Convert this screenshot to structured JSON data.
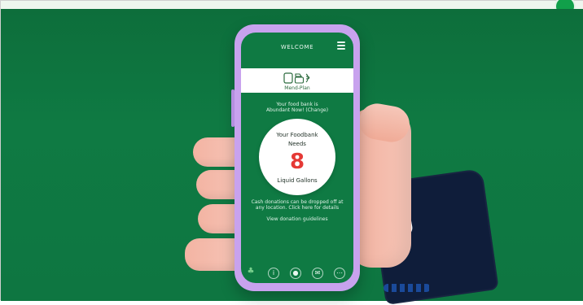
{
  "app": {
    "header_title": "WELCOME",
    "logo_text": "Mend-Plan",
    "subtext": "Your food bank is\nAbundant Now! (Change)",
    "needs": {
      "line1": "Your Foodbank",
      "line2": "Needs",
      "number": "8",
      "units": "Liquid Gallons"
    },
    "hint": "Cash donations can be dropped off at any location. Click here for details",
    "link": "View donation guidelines",
    "nav": {
      "home_icon": "clover-icon",
      "info_icon": "info-icon",
      "mic_icon": "microphone-icon",
      "chat_icon": "chat-icon",
      "more_icon": "more-icon"
    }
  },
  "colors": {
    "background": "#0f7a43",
    "phone_frame": "#c8a2ee",
    "accent_red": "#e53935",
    "sleeve": "#0f1d3a",
    "skin": "#f3b4a3"
  }
}
